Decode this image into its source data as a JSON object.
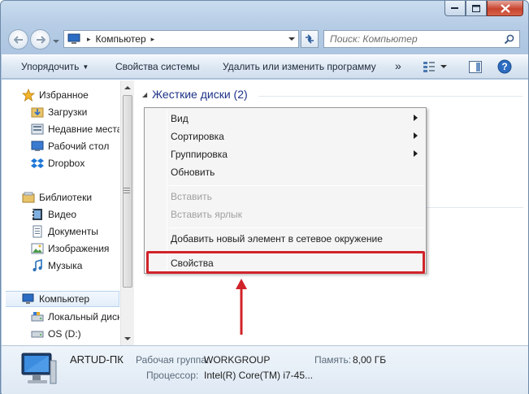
{
  "window": {
    "caption_buttons": [
      "minimize",
      "maximize",
      "close"
    ]
  },
  "nav": {
    "address_segments": [
      "Компьютер"
    ],
    "search_placeholder": "Поиск: Компьютер"
  },
  "toolbar": {
    "organize": "Упорядочить",
    "system_properties": "Свойства системы",
    "uninstall": "Удалить или изменить программу",
    "more": "»"
  },
  "sidebar": {
    "favorites": {
      "label": "Избранное",
      "items": [
        "Загрузки",
        "Недавние места",
        "Рабочий стол",
        "Dropbox"
      ]
    },
    "libraries": {
      "label": "Библиотеки",
      "items": [
        "Видео",
        "Документы",
        "Изображения",
        "Музыка"
      ]
    },
    "computer": {
      "label": "Компьютер",
      "items": [
        "Локальный диск",
        "OS (D:)"
      ]
    }
  },
  "main": {
    "group_title": "Жесткие диски (2)"
  },
  "context_menu": {
    "items": [
      {
        "label": "Вид",
        "submenu": true,
        "disabled": false
      },
      {
        "label": "Сортировка",
        "submenu": true,
        "disabled": false
      },
      {
        "label": "Группировка",
        "submenu": true,
        "disabled": false
      },
      {
        "label": "Обновить",
        "submenu": false,
        "disabled": false
      },
      {
        "label": "Вставить",
        "submenu": false,
        "disabled": true
      },
      {
        "label": "Вставить ярлык",
        "submenu": false,
        "disabled": true
      },
      {
        "label": "Добавить новый элемент в сетевое окружение",
        "submenu": false,
        "disabled": false
      },
      {
        "label": "Свойства",
        "submenu": false,
        "disabled": false
      }
    ]
  },
  "details": {
    "pc_name": "ARTUD-ПК",
    "workgroup_label": "Рабочая группа:",
    "workgroup_value": "WORKGROUP",
    "memory_label": "Память:",
    "memory_value": "8,00 ГБ",
    "cpu_label": "Процессор:",
    "cpu_value": "Intel(R) Core(TM) i7-45..."
  },
  "colors": {
    "annotation_red": "#d0232a",
    "group_title": "#1e3287",
    "frame_blue": "#aec6e1"
  }
}
